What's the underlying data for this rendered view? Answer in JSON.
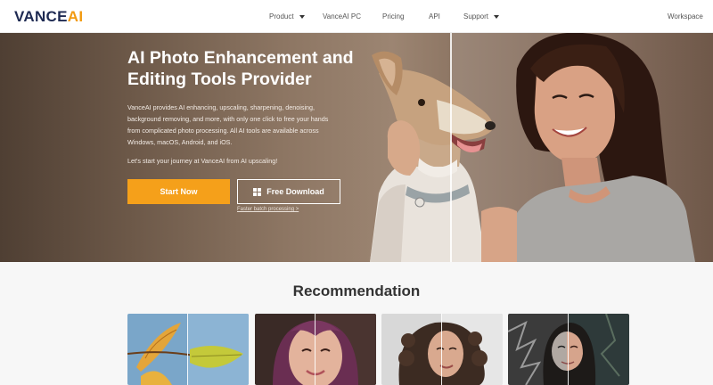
{
  "header": {
    "logo_main": "VANCE",
    "logo_accent": "AI",
    "nav": [
      {
        "label": "Product",
        "has_dropdown": true
      },
      {
        "label": "VanceAI PC",
        "has_dropdown": false
      },
      {
        "label": "Pricing",
        "has_dropdown": false
      },
      {
        "label": "API",
        "has_dropdown": false
      },
      {
        "label": "Support",
        "has_dropdown": true
      }
    ],
    "workspace_label": "Workspace"
  },
  "hero": {
    "title": "AI Photo Enhancement and Editing Tools Provider",
    "description": "VanceAI provides AI enhancing, upscaling, sharpening, denoising, background removing, and more, with only one click to free your hands from complicated photo processing. All AI tools are available across Windows, macOS, Android, and iOS.",
    "cta_text": "Let's start your journey at VanceAI from AI upscaling!",
    "start_button": "Start Now",
    "download_button": "Free Download",
    "batch_link": "Faster batch processing >"
  },
  "recommendation": {
    "title": "Recommendation"
  },
  "colors": {
    "brand_navy": "#1e2a52",
    "brand_orange": "#f29a10",
    "button_orange": "#f5a01a"
  },
  "icons": [
    "chevron-down-icon",
    "windows-icon"
  ]
}
